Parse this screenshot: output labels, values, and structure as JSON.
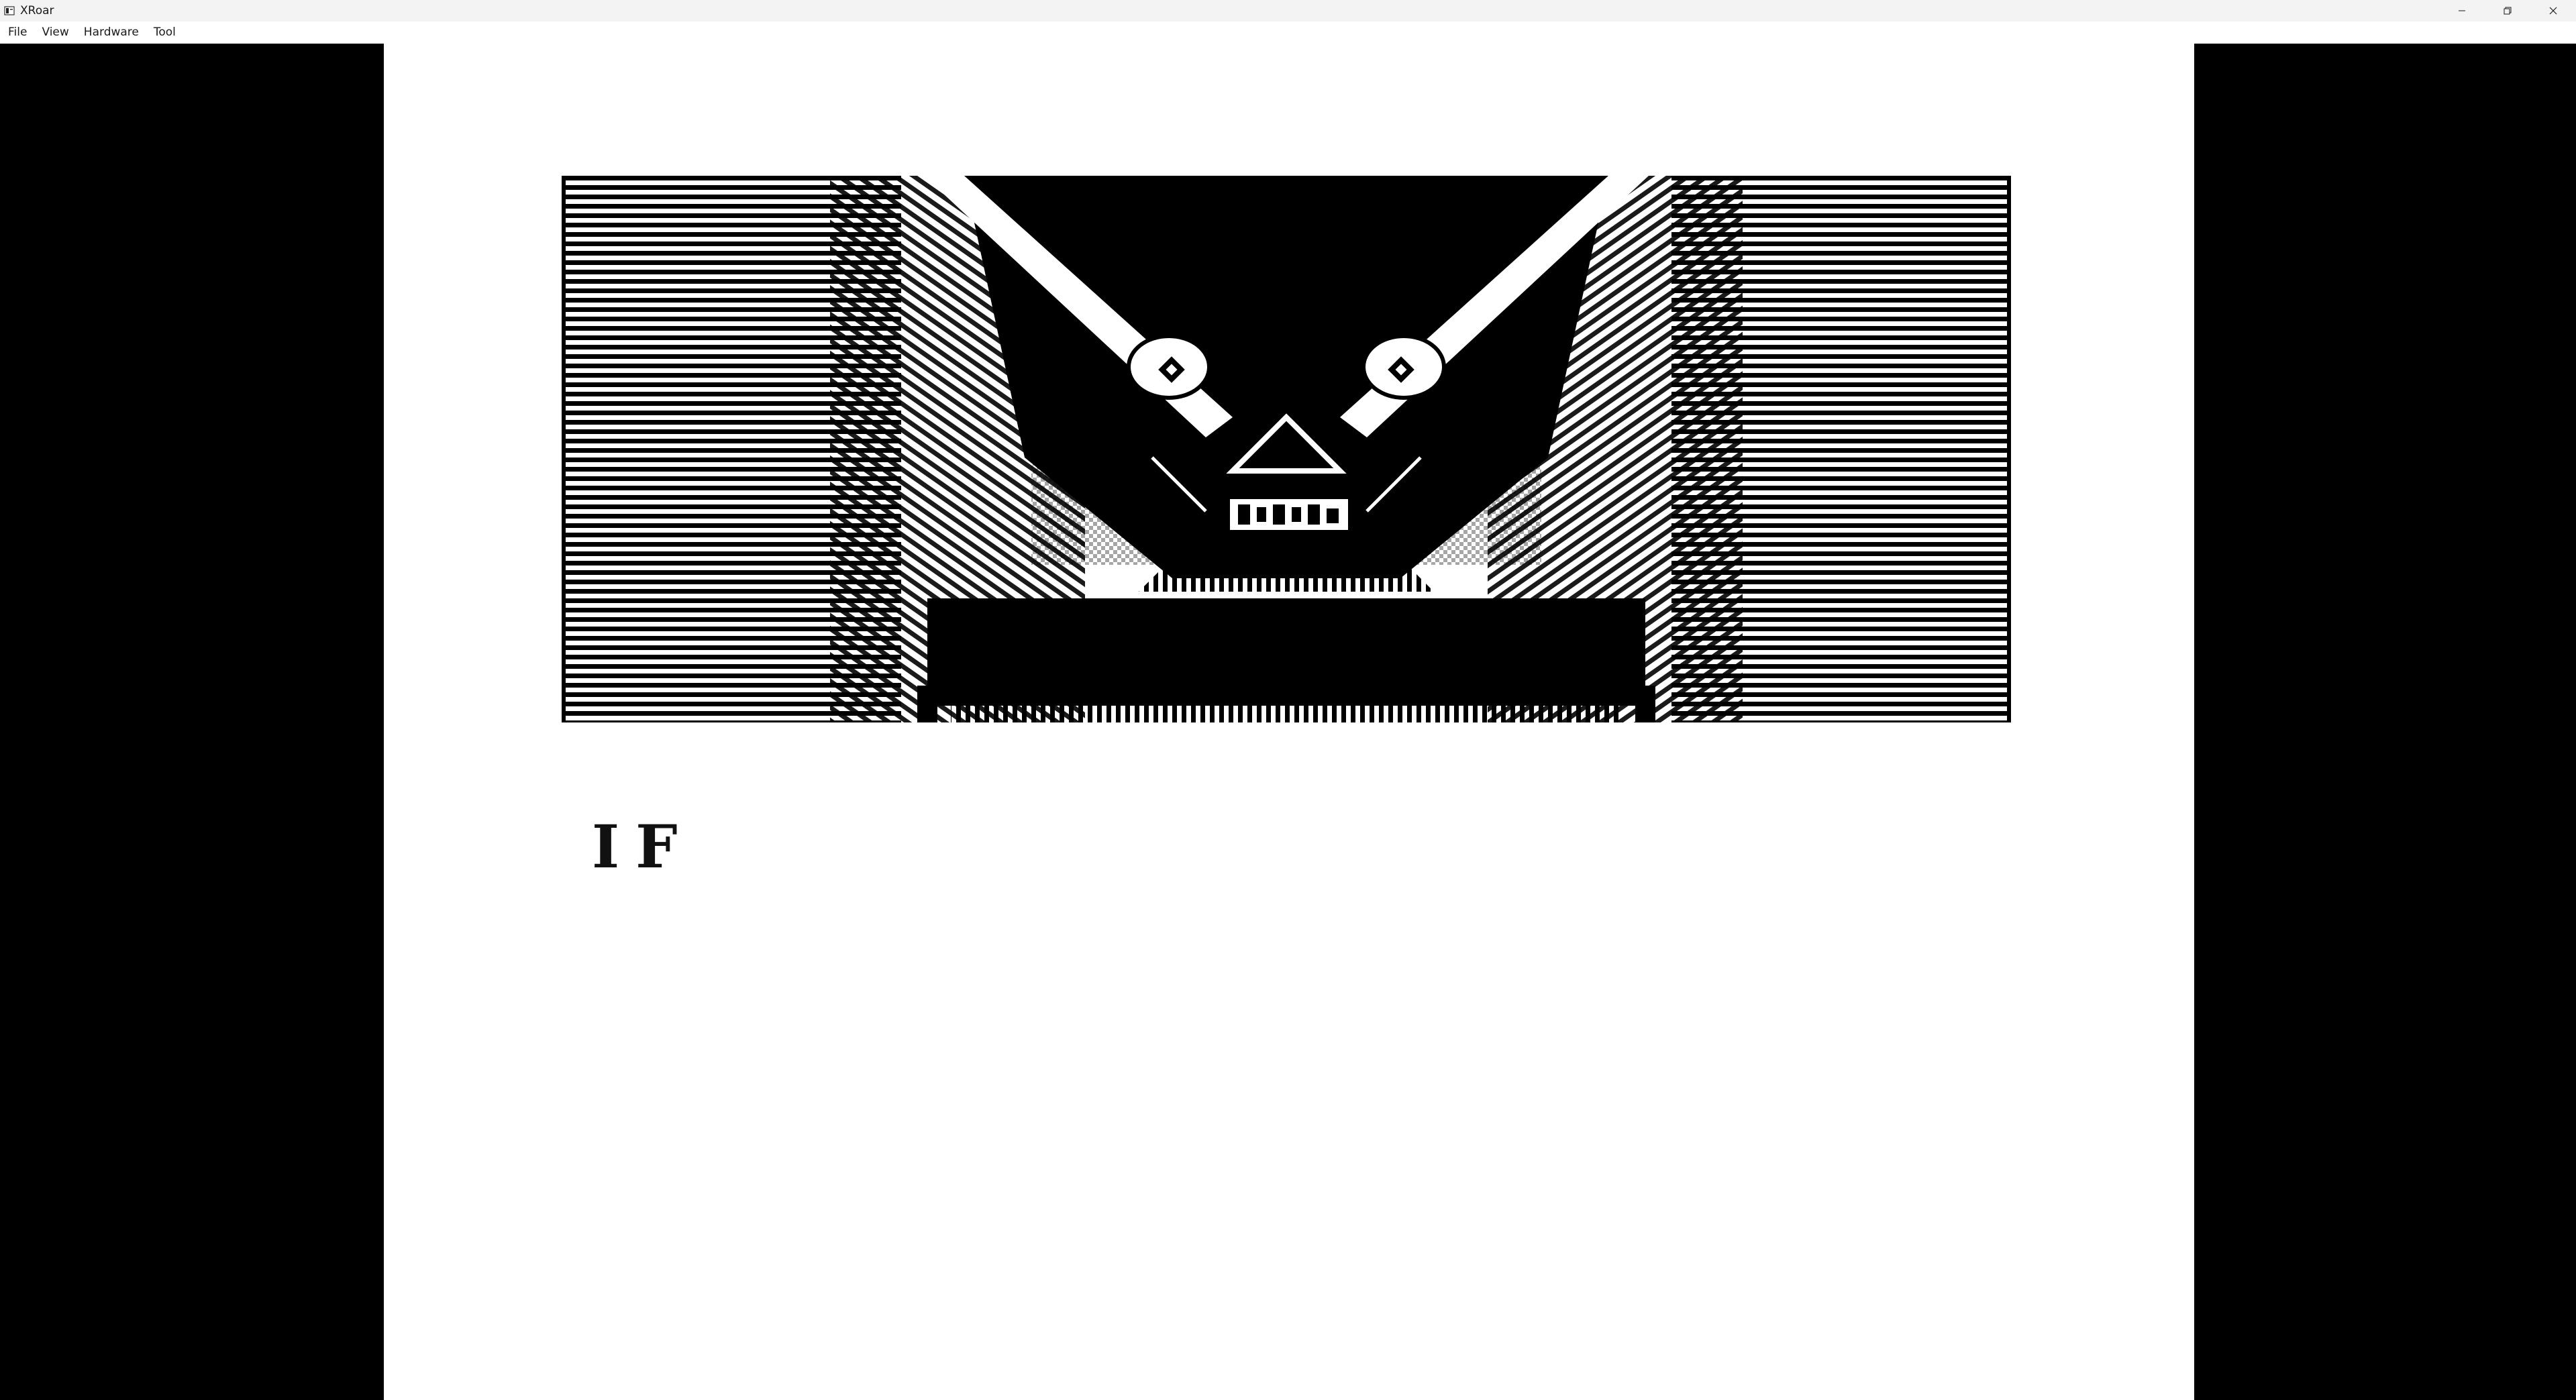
{
  "window": {
    "title": "XRoar",
    "controls": [
      "minimize-icon",
      "restore-icon",
      "close-icon"
    ]
  },
  "menubar": {
    "items": [
      {
        "label": "File"
      },
      {
        "label": "View"
      },
      {
        "label": "Hardware"
      },
      {
        "label": "Tool"
      }
    ]
  },
  "screen": {
    "text": "IF",
    "colors": {
      "border": "#000000",
      "background": "#ffffff",
      "ink": "#000000"
    }
  }
}
